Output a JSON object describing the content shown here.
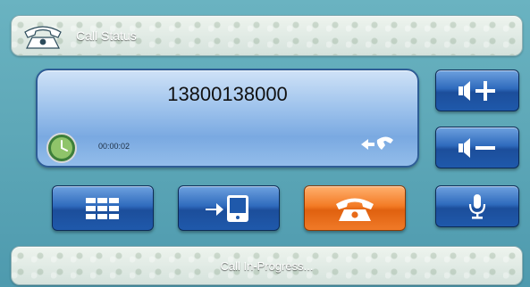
{
  "header": {
    "title": "Call Status",
    "icon": "telephone-icon"
  },
  "call": {
    "number": "13800138000",
    "elapsed": "00:00:02",
    "clock_icon": "clock-icon",
    "transfer_icon": "call-transfer-icon"
  },
  "buttons": {
    "volume_up": {
      "icon": "speaker-plus-icon"
    },
    "volume_down": {
      "icon": "speaker-minus-icon"
    },
    "keypad": {
      "icon": "keypad-grid-icon"
    },
    "transfer_device": {
      "icon": "transfer-to-device-icon"
    },
    "hangup": {
      "icon": "telephone-icon",
      "color": "#f07a28"
    },
    "microphone": {
      "icon": "microphone-icon"
    }
  },
  "status": {
    "text": "Call In-Progress..."
  },
  "colors": {
    "background": "#5ea8b8",
    "button_blue": "#2f6bbd",
    "button_orange": "#f07a28",
    "panel_blue": "#9dc2ec"
  }
}
